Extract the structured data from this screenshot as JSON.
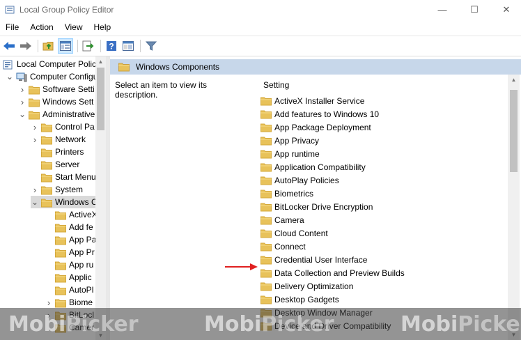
{
  "window": {
    "title": "Local Group Policy Editor",
    "minimize_glyph": "—",
    "maximize_glyph": "☐",
    "close_glyph": "✕"
  },
  "menu": [
    "File",
    "Action",
    "View",
    "Help"
  ],
  "toolbar_icons": [
    "back-arrow-icon",
    "forward-arrow-icon",
    "up-folder-icon",
    "show-hide-tree-icon",
    "export-list-icon",
    "help-icon",
    "properties-icon",
    "filter-icon"
  ],
  "tree": [
    {
      "label": "Local Computer Polic",
      "indent": 0,
      "expander": "",
      "icon": "policy"
    },
    {
      "label": "Computer Configu",
      "indent": 1,
      "expander": "v",
      "icon": "computer"
    },
    {
      "label": "Software Setti",
      "indent": 2,
      "expander": ">",
      "icon": "folder"
    },
    {
      "label": "Windows Sett",
      "indent": 2,
      "expander": ">",
      "icon": "folder"
    },
    {
      "label": "Administrative",
      "indent": 2,
      "expander": "v",
      "icon": "folder"
    },
    {
      "label": "Control Pa",
      "indent": 3,
      "expander": ">",
      "icon": "folder"
    },
    {
      "label": "Network",
      "indent": 3,
      "expander": ">",
      "icon": "folder"
    },
    {
      "label": "Printers",
      "indent": 3,
      "expander": "",
      "icon": "folder"
    },
    {
      "label": "Server",
      "indent": 3,
      "expander": "",
      "icon": "folder"
    },
    {
      "label": "Start Menu",
      "indent": 3,
      "expander": "",
      "icon": "folder"
    },
    {
      "label": "System",
      "indent": 3,
      "expander": ">",
      "icon": "folder"
    },
    {
      "label": "Windows C",
      "indent": 3,
      "expander": "v",
      "icon": "folder",
      "selected": true
    },
    {
      "label": "ActiveX",
      "indent": 4,
      "expander": "",
      "icon": "folder"
    },
    {
      "label": "Add fe",
      "indent": 4,
      "expander": "",
      "icon": "folder"
    },
    {
      "label": "App Pa",
      "indent": 4,
      "expander": "",
      "icon": "folder"
    },
    {
      "label": "App Pr",
      "indent": 4,
      "expander": "",
      "icon": "folder"
    },
    {
      "label": "App ru",
      "indent": 4,
      "expander": "",
      "icon": "folder"
    },
    {
      "label": "Applic",
      "indent": 4,
      "expander": "",
      "icon": "folder"
    },
    {
      "label": "AutoPl",
      "indent": 4,
      "expander": "",
      "icon": "folder"
    },
    {
      "label": "Biome",
      "indent": 4,
      "expander": ">",
      "icon": "folder"
    },
    {
      "label": "BitLocl",
      "indent": 4,
      "expander": ">",
      "icon": "folder"
    },
    {
      "label": "Camer",
      "indent": 4,
      "expander": "",
      "icon": "folder"
    }
  ],
  "right": {
    "header": "Windows Components",
    "description": "Select an item to view its description.",
    "column_header": "Setting",
    "items": [
      "ActiveX Installer Service",
      "Add features to Windows 10",
      "App Package Deployment",
      "App Privacy",
      "App runtime",
      "Application Compatibility",
      "AutoPlay Policies",
      "Biometrics",
      "BitLocker Drive Encryption",
      "Camera",
      "Cloud Content",
      "Connect",
      "Credential User Interface",
      "Data Collection and Preview Builds",
      "Delivery Optimization",
      "Desktop Gadgets",
      "Desktop Window Manager",
      "Device and Driver Compatibility"
    ],
    "highlighted_item": "Data Collection and Preview Builds"
  },
  "watermark": {
    "part1": "Mobi",
    "part2": "Picker"
  },
  "colors": {
    "folder": "#e8c25a",
    "folder_dark": "#d4a83a",
    "header_bg": "#c7d7ea",
    "selection": "#d9d9d9",
    "arrow": "#e02020",
    "accent_blue": "#2a6fc9"
  }
}
